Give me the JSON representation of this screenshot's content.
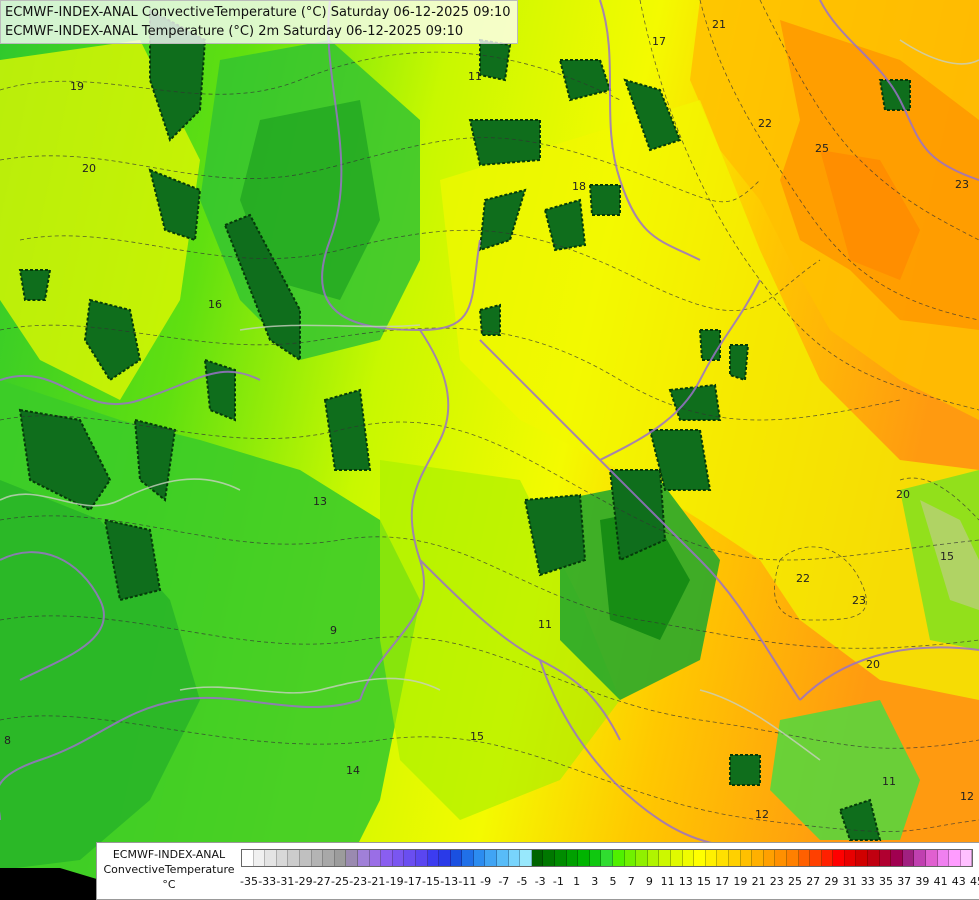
{
  "titles": {
    "line1": "ECMWF-INDEX-ANAL ConvectiveTemperature (°C) Saturday 06-12-2025 09:10",
    "line2": "ECMWF-INDEX-ANAL Temperature (°C) 2m Saturday 06-12-2025 09:10"
  },
  "legend": {
    "line1": "ECMWF-INDEX-ANAL",
    "line2": "ConvectiveTemperature",
    "line3": "°C",
    "ticks": [
      "-35",
      "-33",
      "-31",
      "-29",
      "-27",
      "-25",
      "-23",
      "-21",
      "-19",
      "-17",
      "-15",
      "-13",
      "-11",
      "-9",
      "-7",
      "-5",
      "-3",
      "-1",
      "1",
      "3",
      "5",
      "7",
      "9",
      "11",
      "13",
      "15",
      "17",
      "19",
      "21",
      "23",
      "25",
      "27",
      "29",
      "31",
      "33",
      "35",
      "37",
      "39",
      "41",
      "43",
      "45"
    ],
    "colors": [
      "#ffffff",
      "#f0f0f0",
      "#e4e4e4",
      "#d8d8d8",
      "#cccccc",
      "#c0c0c0",
      "#b4b4b4",
      "#a8a8a8",
      "#9c9c9c",
      "#9a8ab0",
      "#a080d8",
      "#9a6ee6",
      "#8a5ef0",
      "#7a56f0",
      "#6a4ef0",
      "#5a46f0",
      "#3c3cf0",
      "#2a3ae8",
      "#1a50e0",
      "#2070e8",
      "#2c8cf0",
      "#40a4f4",
      "#58bcf8",
      "#78d4fc",
      "#98e8fc",
      "#006400",
      "#007800",
      "#008c00",
      "#00a000",
      "#00b400",
      "#10c810",
      "#30dc30",
      "#50f000",
      "#70f000",
      "#90f000",
      "#b0f400",
      "#ccf800",
      "#e0fa00",
      "#f0fc00",
      "#ffff00",
      "#fff000",
      "#ffe000",
      "#ffd000",
      "#ffc000",
      "#ffb000",
      "#ffa000",
      "#ff9000",
      "#ff8000",
      "#ff6000",
      "#ff4000",
      "#ff2000",
      "#ff0000",
      "#e80000",
      "#d00000",
      "#c00010",
      "#b00030",
      "#a00050",
      "#a02080",
      "#c040b0",
      "#e060d0",
      "#f080f0",
      "#ff9cff",
      "#ffc0ff"
    ]
  },
  "contour_labels": [
    "19",
    "17",
    "20",
    "21",
    "22",
    "23",
    "25",
    "18",
    "16",
    "13",
    "20",
    "15",
    "11",
    "22",
    "23",
    "20",
    "11",
    "12",
    "15",
    "9",
    "8",
    "14",
    "11",
    "12"
  ]
}
